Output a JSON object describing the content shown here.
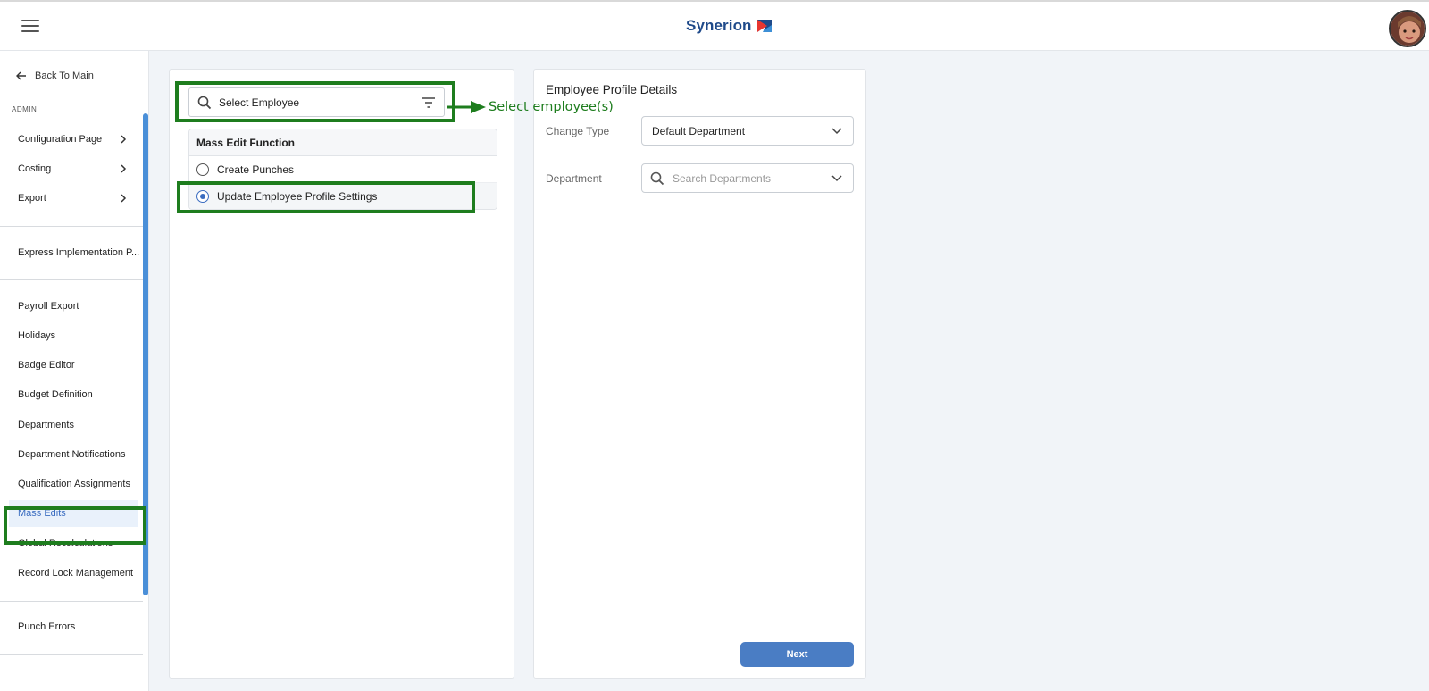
{
  "header": {
    "brand": "Synerion",
    "menu_icon": "hamburger-icon",
    "avatar_icon": "user-avatar"
  },
  "sidebar": {
    "back_label": "Back To Main",
    "section": "ADMIN",
    "groups": [
      {
        "items": [
          {
            "label": "Configuration Page",
            "has_children": true
          },
          {
            "label": "Costing",
            "has_children": true
          },
          {
            "label": "Export",
            "has_children": true
          }
        ]
      },
      {
        "items": [
          {
            "label": "Express Implementation P..."
          }
        ]
      },
      {
        "items": [
          {
            "label": "Payroll Export"
          },
          {
            "label": "Holidays"
          },
          {
            "label": "Badge Editor"
          },
          {
            "label": "Budget Definition"
          },
          {
            "label": "Departments"
          },
          {
            "label": "Department Notifications"
          },
          {
            "label": "Qualification Assignments"
          },
          {
            "label": "Mass Edits",
            "active": true
          },
          {
            "label": "Global Recalculations"
          },
          {
            "label": "Record Lock Management"
          }
        ]
      },
      {
        "items": [
          {
            "label": "Punch Errors"
          }
        ]
      }
    ]
  },
  "left_panel": {
    "employee_search": "Select Employee",
    "mass_edit": {
      "header": "Mass Edit Function",
      "options": [
        {
          "label": "Create Punches",
          "selected": false
        },
        {
          "label": "Update Employee Profile Settings",
          "selected": true
        }
      ]
    }
  },
  "right_panel": {
    "title": "Employee Profile Details",
    "change_type_label": "Change Type",
    "change_type_value": "Default Department",
    "department_label": "Department",
    "department_placeholder": "Search Departments",
    "next_label": "Next"
  },
  "annotation": {
    "callout": "Select employee(s)",
    "color": "#1e7d1e"
  },
  "colors": {
    "accent": "#3a6cc0",
    "brand": "#1f4a8a",
    "button": "#4a7dc4",
    "scrollbar": "#4a8fd8"
  }
}
